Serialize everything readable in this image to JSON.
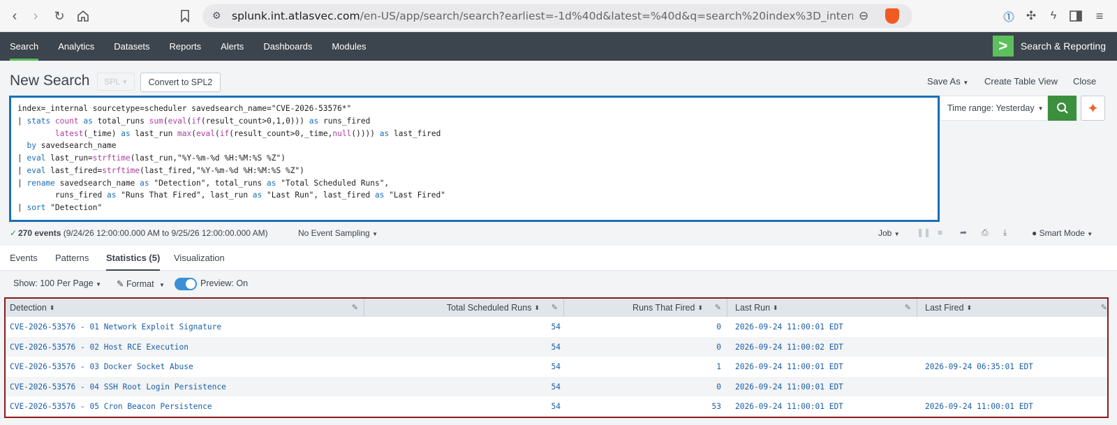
{
  "browser": {
    "url_host": "splunk.int.atlasvec.com",
    "url_path": "/en-US/app/search/search?earliest=-1d%40d&latest=%40d&q=search%20index%3D_internal%..."
  },
  "app_nav": {
    "items": [
      "Search",
      "Analytics",
      "Datasets",
      "Reports",
      "Alerts",
      "Dashboards",
      "Modules"
    ],
    "brand": "Search & Reporting"
  },
  "header": {
    "title": "New Search",
    "spl_label": "SPL",
    "convert_label": "Convert to SPL2",
    "save_as": "Save As",
    "create_table_view": "Create Table View",
    "close": "Close"
  },
  "search": {
    "lines": [
      "index=_internal sourcetype=scheduler savedsearch_name=\"CVE-2026-53576*\"",
      "| stats count as total_runs sum(eval(if(result_count>0,1,0))) as runs_fired",
      "        latest(_time) as last_run max(eval(if(result_count>0,_time,null()))) as last_fired",
      "  by savedsearch_name",
      "| eval last_run=strftime(last_run,\"%Y-%m-%d %H:%M:%S %Z\")",
      "| eval last_fired=strftime(last_fired,\"%Y-%m-%d %H:%M:%S %Z\")",
      "| rename savedsearch_name as \"Detection\", total_runs as \"Total Scheduled Runs\",",
      "        runs_fired as \"Runs That Fired\", last_run as \"Last Run\", last_fired as \"Last Fired\"",
      "| sort \"Detection\""
    ],
    "time_range": "Time range: Yesterday"
  },
  "status": {
    "check": "✓",
    "events_count": "270 events",
    "events_range": "(9/24/26 12:00:00.000 AM to 9/25/26 12:00:00.000 AM)",
    "sampling": "No Event Sampling",
    "job": "Job",
    "mode": "Smart Mode"
  },
  "tabs": [
    "Events",
    "Patterns",
    "Statistics (5)",
    "Visualization"
  ],
  "controls": {
    "show": "Show: 100 Per Page",
    "format": "Format",
    "preview": "Preview: On"
  },
  "table": {
    "columns": [
      "Detection",
      "Total Scheduled Runs",
      "Runs That Fired",
      "Last Run",
      "Last Fired"
    ],
    "rows": [
      [
        "CVE-2026-53576 - 01 Network Exploit Signature",
        "54",
        "0",
        "2026-09-24 11:00:01 EDT",
        ""
      ],
      [
        "CVE-2026-53576 - 02 Host RCE Execution",
        "54",
        "0",
        "2026-09-24 11:00:02 EDT",
        ""
      ],
      [
        "CVE-2026-53576 - 03 Docker Socket Abuse",
        "54",
        "1",
        "2026-09-24 11:00:01 EDT",
        "2026-09-24 06:35:01 EDT"
      ],
      [
        "CVE-2026-53576 - 04 SSH Root Login Persistence",
        "54",
        "0",
        "2026-09-24 11:00:01 EDT",
        ""
      ],
      [
        "CVE-2026-53576 - 05 Cron Beacon Persistence",
        "54",
        "53",
        "2026-09-24 11:00:01 EDT",
        "2026-09-24 11:00:01 EDT"
      ]
    ]
  }
}
